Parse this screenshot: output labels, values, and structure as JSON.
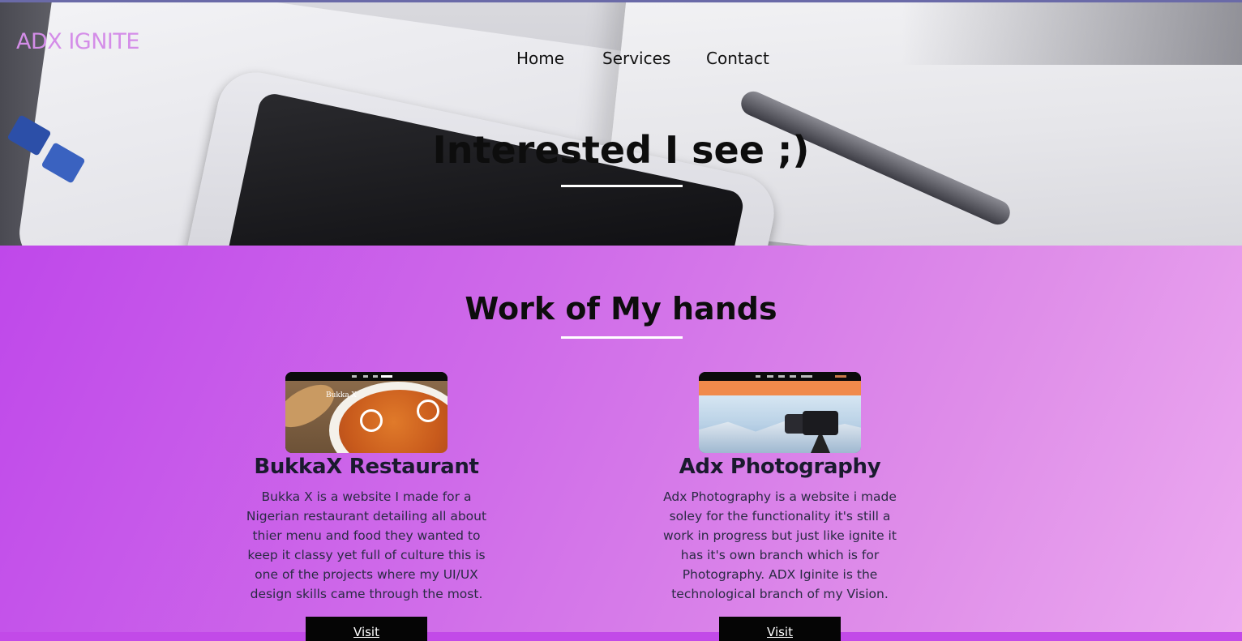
{
  "brand": {
    "logo": "ADX IGNITE"
  },
  "nav": {
    "items": [
      "Home",
      "Services",
      "Contact"
    ]
  },
  "hero": {
    "title": "Interested I see ;)"
  },
  "work": {
    "title": "Work of My hands",
    "projects": [
      {
        "thumb_label": "Bukka X",
        "title": "BukkaX Restaurant",
        "description": "Bukka X is a website I made for a Nigerian restaurant detailing all about thier menu and food they wanted to keep it classy yet full of culture this is one of the projects where my UI/UX design skills came through the most.",
        "button": "Visit"
      },
      {
        "thumb_label": "Adx Photography",
        "title": "Adx Photography",
        "description": "Adx Photography is a website i made soley for the functionality it's still a work in progress but just like ignite it has it's own branch which is for Photography. ADX Iginite is the technological branch of my Vision.",
        "button": "Visit"
      }
    ]
  },
  "colors": {
    "logo": "#d48de8",
    "section_gradient_start": "#bf48ea",
    "section_gradient_end": "#ecaaf0",
    "button_bg": "#050505",
    "underline": "#ffffff"
  }
}
